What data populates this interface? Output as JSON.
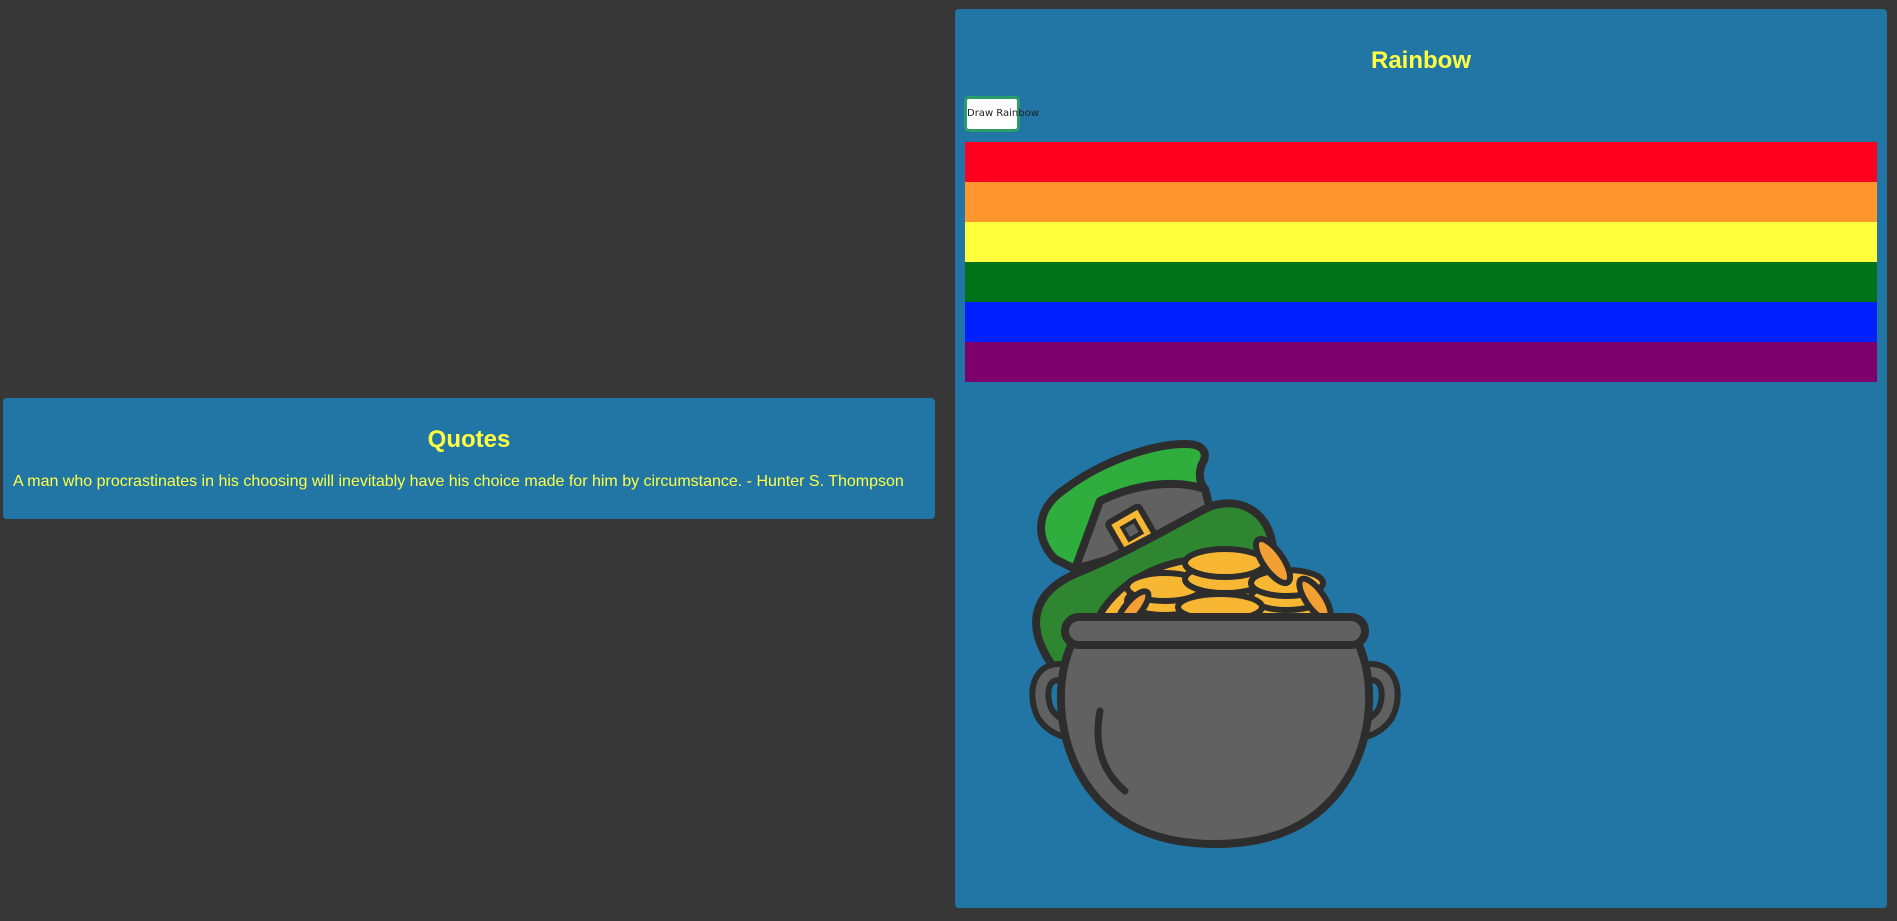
{
  "quotes": {
    "title": "Quotes",
    "text": "A man who procrastinates in his choosing will inevitably have his choice made for him by circumstance. - Hunter S. Thompson"
  },
  "rainbow": {
    "title": "Rainbow",
    "button_label": "Draw Rainbow",
    "stripes": [
      "#ff0020",
      "#ff962d",
      "#ffff3c",
      "#00731a",
      "#0020ff",
      "#7d006d"
    ]
  },
  "image": {
    "icon": "pot-of-gold-with-leprechaun-hat-icon"
  },
  "colors": {
    "background": "#373737",
    "panel": "#2176a5",
    "heading_text": "#ffff44"
  }
}
